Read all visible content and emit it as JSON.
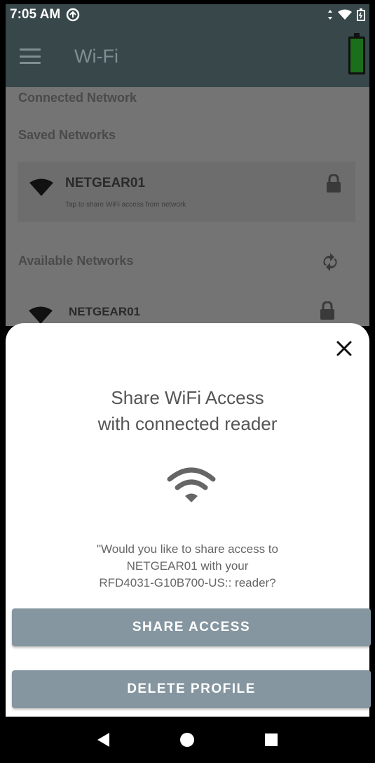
{
  "status_bar": {
    "time": "7:05 AM",
    "status_icons": [
      "sync-icon",
      "wifi-icon",
      "battery-icon"
    ]
  },
  "app_bar": {
    "title": "Wi-Fi",
    "menu_icon": "hamburger-menu-icon",
    "battery_color": "#1b6f1b"
  },
  "background": {
    "connected_label": "Connected Network",
    "saved_label": "Saved Networks",
    "saved_network": {
      "name": "NETGEAR01",
      "subtitle": "Tap to share WiFi access from network"
    },
    "available_label": "Available Networks",
    "available_network": {
      "name": "NETGEAR01"
    }
  },
  "sheet": {
    "title_line1": "Share WiFi Access",
    "title_line2": "with connected reader",
    "message_line1": "\"Would you like to share access to",
    "message_line2": "NETGEAR01 with your",
    "message_line3": "RFD4031-G10B700-US:: reader?",
    "share_button": "SHARE ACCESS",
    "delete_button": "DELETE PROFILE",
    "button_color": "#8596a0"
  },
  "nav_bar": {
    "buttons": [
      "back-icon",
      "home-icon",
      "recents-icon"
    ]
  }
}
